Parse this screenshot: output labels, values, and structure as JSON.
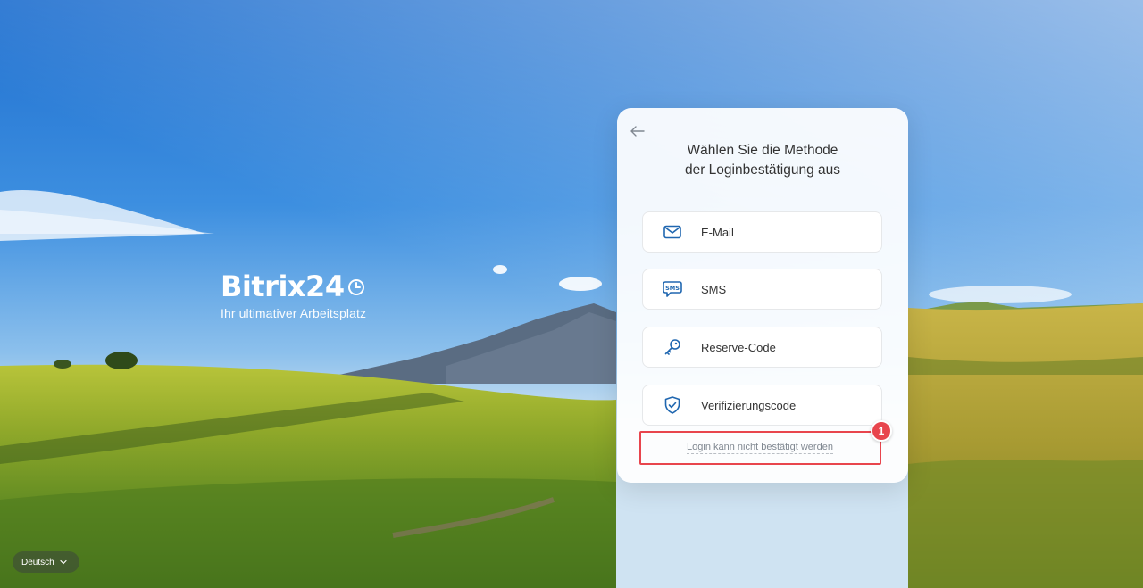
{
  "brand": {
    "logo_text": "Bitrix24",
    "tagline": "Ihr ultimativer Arbeitsplatz"
  },
  "dialog": {
    "title_line1": "Wählen Sie die Methode",
    "title_line2": "der Loginbestätigung aus",
    "methods": [
      {
        "label": "E-Mail",
        "icon": "mail-icon"
      },
      {
        "label": "SMS",
        "icon": "sms-icon",
        "icon_text": "SMS"
      },
      {
        "label": "Reserve-Code",
        "icon": "key-icon"
      },
      {
        "label": "Verifizierungscode",
        "icon": "shield-check-icon"
      }
    ],
    "cant_confirm_link": "Login kann nicht bestätigt werden"
  },
  "annotation": {
    "marker_number": "1",
    "color": "#e8454d"
  },
  "language": {
    "selected": "Deutsch"
  },
  "colors": {
    "accent": "#2067b0",
    "card_bg": "#ffffff",
    "text": "#333333",
    "muted_text": "#808891"
  }
}
